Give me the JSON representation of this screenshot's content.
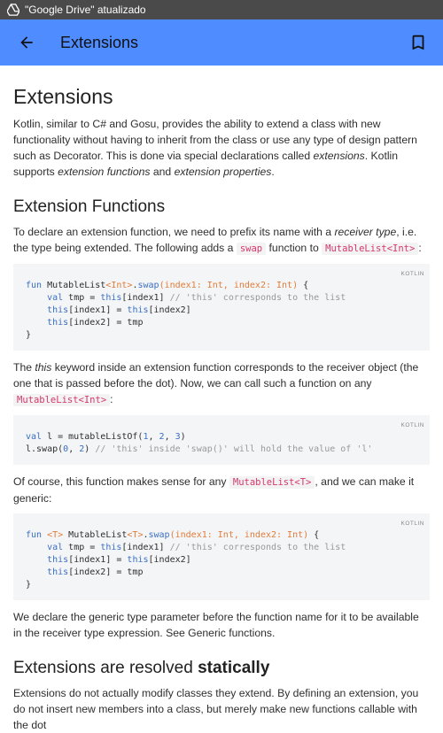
{
  "status": {
    "notification_text": "\"Google Drive\" atualizado"
  },
  "appbar": {
    "title": "Extensions",
    "back_icon": "arrow-back-icon",
    "bookmark_icon": "bookmark-icon",
    "color": "#4e8cff"
  },
  "article": {
    "h1": "Extensions",
    "intro": {
      "a": "Kotlin, similar to C# and Gosu, provides the ability to extend a class with new functionality without having to inherit from the class or use any type of design pattern such as Decorator. This is done via special declarations called ",
      "em1": "extensions",
      "b": ". Kotlin supports ",
      "em2": "extension functions",
      "c": " and ",
      "em3": "extension properties",
      "d": "."
    },
    "h2_ext_functions": "Extension Functions",
    "p2": {
      "a": "To declare an extension function, we need to prefix its name with a ",
      "em": "receiver type",
      "b": ", i.e. the type being extended. The following adds a ",
      "code1": "swap",
      "c": " function to ",
      "code2": "MutableList<Int>",
      "d": ":"
    },
    "code_lang": "KOTLIN",
    "code1": {
      "l1": {
        "kw": "fun",
        "cls": " MutableList",
        "lt": "<",
        "typ": "Int",
        "gt": ">",
        "dot": ".",
        "fn": "swap",
        "sig": "(index1: Int, index2: Int)",
        "end": " {"
      },
      "l2": {
        "pre": "    ",
        "kw": "val",
        "a": " tmp = ",
        "kw2": "this",
        "b": "[index1] ",
        "cm": "// 'this' corresponds to the list"
      },
      "l3": {
        "pre": "    ",
        "kw": "this",
        "a": "[index1] = ",
        "kw2": "this",
        "b": "[index2]"
      },
      "l4": {
        "pre": "    ",
        "kw": "this",
        "a": "[index2] = tmp"
      },
      "l5": "}"
    },
    "p3": {
      "a": "The ",
      "em": "this",
      "b": " keyword inside an extension function corresponds to the receiver object (the one that is passed before the dot). Now, we can call such a function on any ",
      "code": "MutableList<Int>",
      "c": ":"
    },
    "code2": {
      "l1": {
        "kw": "val",
        "a": " l = mutableListOf(",
        "n1": "1",
        "c1": ", ",
        "n2": "2",
        "c2": ", ",
        "n3": "3",
        "end": ")"
      },
      "l2": {
        "a": "l.swap(",
        "n1": "0",
        "c1": ", ",
        "n2": "2",
        "b": ") ",
        "cm": "// 'this' inside 'swap()' will hold the value of 'l'"
      }
    },
    "p4": {
      "a": "Of course, this function makes sense for any ",
      "code": "MutableList<T>",
      "b": ", and we can make it generic:"
    },
    "code3": {
      "l1": {
        "kw": "fun",
        "sp": " ",
        "tp": "<T>",
        "cls": " MutableList",
        "t2": "<T>",
        "dot": ".",
        "fn": "swap",
        "sig": "(index1: Int, index2: Int)",
        "end": " {"
      },
      "l2": {
        "pre": "    ",
        "kw": "val",
        "a": " tmp = ",
        "kw2": "this",
        "b": "[index1] ",
        "cm": "// 'this' corresponds to the list"
      },
      "l3": {
        "pre": "    ",
        "kw": "this",
        "a": "[index1] = ",
        "kw2": "this",
        "b": "[index2]"
      },
      "l4": {
        "pre": "    ",
        "kw": "this",
        "a": "[index2] = tmp"
      },
      "l5": "}"
    },
    "p5": "We declare the generic type parameter before the function name for it to be available in the receiver type expression. See Generic functions.",
    "h2_static": {
      "a": "Extensions are resolved ",
      "b": "statically"
    },
    "p6": "Extensions do not actually modify classes they extend. By defining an extension, you do not insert new members into a class, but merely make new functions callable with the dot"
  }
}
